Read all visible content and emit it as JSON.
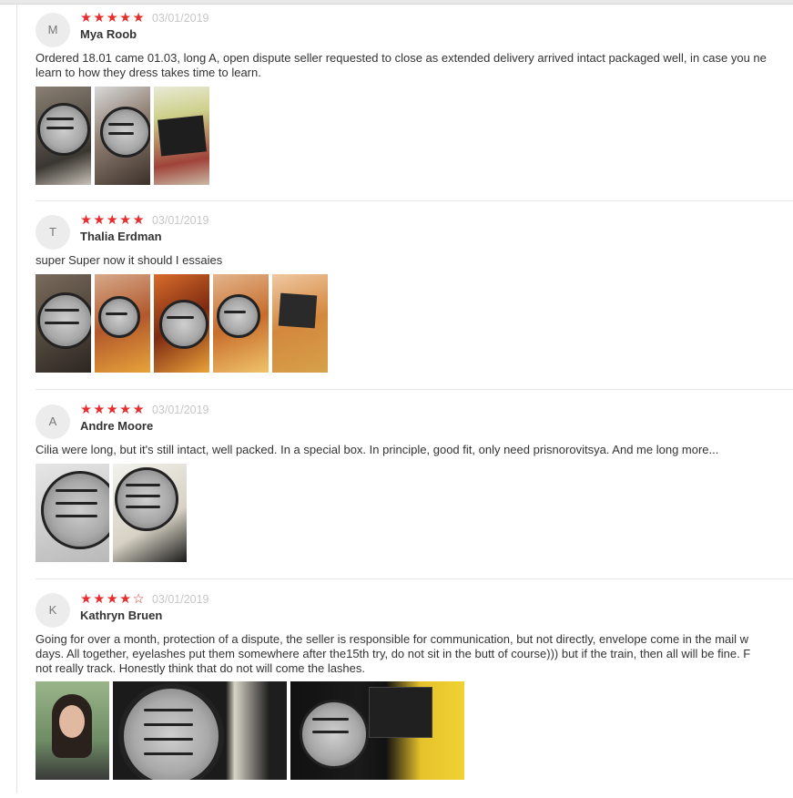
{
  "reviews": [
    {
      "avatar_letter": "M",
      "name": "Mya Roob",
      "rating": 5,
      "date": "03/01/2019",
      "text_lines": [
        "Ordered 18.01 came 01.03, long A, open dispute seller requested to close as extended delivery arrived intact packaged well, in case you ne",
        "learn to how they dress takes time to learn."
      ],
      "photos": [
        {
          "icon": "eyelash-case-photo"
        },
        {
          "icon": "eyelash-case-photo"
        },
        {
          "icon": "product-box-photo"
        }
      ]
    },
    {
      "avatar_letter": "T",
      "name": "Thalia Erdman",
      "rating": 5,
      "date": "03/01/2019",
      "text_lines": [
        "super Super now it should I essaies"
      ],
      "photos": [
        {
          "icon": "eyelash-case-photo"
        },
        {
          "icon": "eyelash-case-photo"
        },
        {
          "icon": "eyelash-case-photo"
        },
        {
          "icon": "eyelash-case-photo"
        },
        {
          "icon": "product-box-photo"
        }
      ]
    },
    {
      "avatar_letter": "A",
      "name": "Andre Moore",
      "rating": 5,
      "date": "03/01/2019",
      "text_lines": [
        "Cilia were long, but it's still intact, well packed. In a special box. In principle, good fit, only need prisnorovitsya. And me long more..."
      ],
      "photos": [
        {
          "icon": "eyelash-case-photo"
        },
        {
          "icon": "eyelash-case-photo"
        }
      ]
    },
    {
      "avatar_letter": "K",
      "name": "Kathryn Bruen",
      "rating": 4,
      "date": "03/01/2019",
      "text_lines": [
        "Going for over a month, protection of a dispute, the seller is responsible for communication, but not directly, envelope come in the mail w",
        "days. All together, eyelashes put them somewhere after the15th try, do not sit in the butt of course))) but if the train, then all will be fine. F",
        "not really track. Honestly think that do not will come the lashes."
      ],
      "photos": [
        {
          "icon": "selfie-photo"
        },
        {
          "icon": "eyelash-case-photo"
        },
        {
          "icon": "product-box-photo"
        }
      ]
    }
  ],
  "colors": {
    "star": "#e62e2e",
    "date": "#c7c7c7",
    "divider": "#e6e6e6"
  }
}
